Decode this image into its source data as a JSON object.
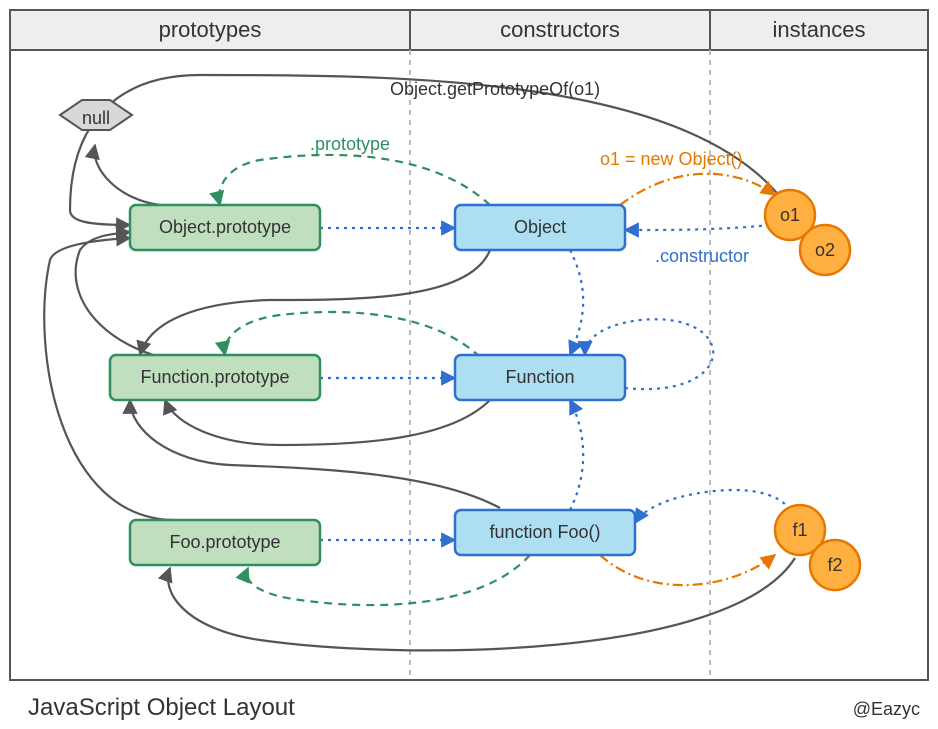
{
  "columns": {
    "prototypes": "prototypes",
    "constructors": "constructors",
    "instances": "instances"
  },
  "nodes": {
    "null": "null",
    "object_prototype": "Object.prototype",
    "function_prototype": "Function.prototype",
    "foo_prototype": "Foo.prototype",
    "object": "Object",
    "function": "Function",
    "function_foo": "function Foo()",
    "o1": "o1",
    "o2": "o2",
    "f1": "f1",
    "f2": "f2"
  },
  "labels": {
    "get_prototype_of": "Object.getPrototypeOf(o1)",
    "prototype_prop": ".prototype",
    "new_object": "o1 = new Object()",
    "constructor_prop": ".constructor"
  },
  "footer": {
    "title": "JavaScript Object Layout",
    "credit": "@Eazyc"
  },
  "colors": {
    "gray_stroke": "#555555",
    "gray_fill": "#d8d8d8",
    "green_fill": "#bfdfbf",
    "green_stroke": "#2f8f5f",
    "blue_fill": "#addef2",
    "blue_stroke": "#2f6fcf",
    "orange_fill": "#ffb040",
    "orange_stroke": "#e67700",
    "header_fill": "#eeeeee"
  }
}
